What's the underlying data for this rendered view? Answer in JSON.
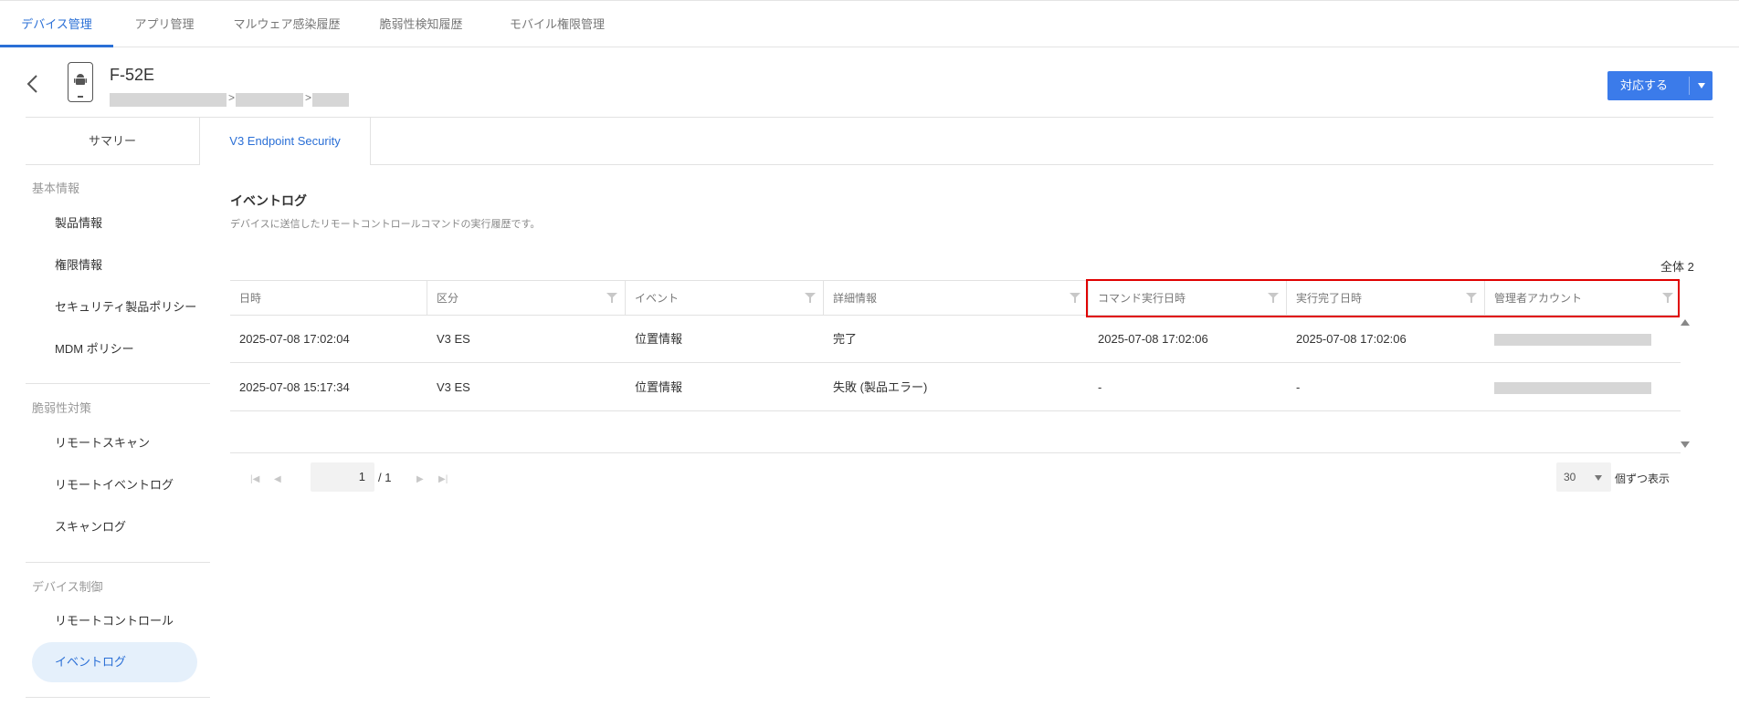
{
  "top_nav": {
    "tabs": [
      {
        "label": "デバイス管理",
        "active": true
      },
      {
        "label": "アプリ管理"
      },
      {
        "label": "マルウェア感染履歴"
      },
      {
        "label": "脆弱性検知履歴"
      },
      {
        "label": "モバイル権限管理"
      }
    ]
  },
  "header": {
    "device_name": "F-52E",
    "breadcrumb_sep": ">",
    "action_button": "対応する",
    "device_icon": "android-phone-icon",
    "back_icon": "chevron-left-icon"
  },
  "sub_tabs": {
    "summary": "サマリー",
    "v3": "V3 Endpoint Security"
  },
  "sidebar": {
    "sections": [
      {
        "title": "基本情報",
        "items": [
          "製品情報",
          "権限情報",
          "セキュリティ製品ポリシー",
          "MDM ポリシー"
        ]
      },
      {
        "title": "脆弱性対策",
        "items": [
          "リモートスキャン",
          "リモートイベントログ",
          "スキャンログ"
        ]
      },
      {
        "title": "デバイス制御",
        "items": [
          "リモートコントロール",
          "イベントログ"
        ]
      }
    ],
    "active_item": "イベントログ"
  },
  "content": {
    "title": "イベントログ",
    "description": "デバイスに送信したリモートコントロールコマンドの実行履歴です。",
    "total_label": "全体 2"
  },
  "table": {
    "columns": [
      "日時",
      "区分",
      "イベント",
      "詳細情報",
      "コマンド実行日時",
      "実行完了日時",
      "管理者アカウント"
    ],
    "rows": [
      [
        "2025-07-08 17:02:04",
        "V3 ES",
        "位置情報",
        "完了",
        "2025-07-08 17:02:06",
        "2025-07-08 17:02:06",
        ""
      ],
      [
        "2025-07-08 15:17:34",
        "V3 ES",
        "位置情報",
        "失敗 (製品エラー)",
        "-",
        "-",
        ""
      ]
    ]
  },
  "pagination": {
    "current_page": "1",
    "total_pages": "/ 1",
    "page_size": "30",
    "page_size_label": "個ずつ表示",
    "first_icon": "first-page-icon",
    "prev_icon": "prev-page-icon",
    "next_icon": "next-page-icon",
    "last_icon": "last-page-icon"
  },
  "colors": {
    "accent": "#2a6fd6",
    "button": "#3b7bea",
    "highlight": "#e00000",
    "active_bg": "#e5f0fb"
  }
}
